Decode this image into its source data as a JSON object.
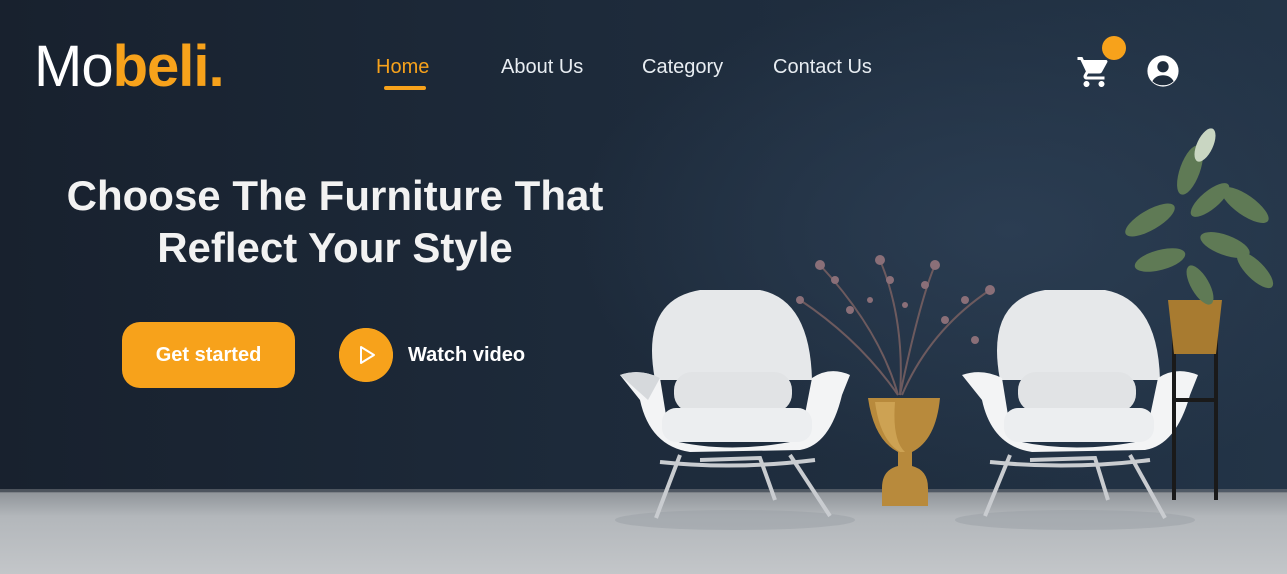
{
  "brand": {
    "part1": "Mo",
    "part2": "beli."
  },
  "nav": {
    "items": [
      {
        "label": "Home",
        "active": true
      },
      {
        "label": "About Us",
        "active": false
      },
      {
        "label": "Category",
        "active": false
      },
      {
        "label": "Contact Us",
        "active": false
      }
    ]
  },
  "header_icons": {
    "cart": "cart-icon",
    "badge": "notification-dot",
    "account": "user-account-icon"
  },
  "hero": {
    "headline_line1": "Choose The Furniture That",
    "headline_line2": "Reflect Your Style",
    "primary_button": "Get started",
    "secondary_action": "Watch video",
    "secondary_icon": "play-icon"
  },
  "colors": {
    "accent": "#f7a21b",
    "wall": "#1c2a3a",
    "text": "#f2f2f2"
  }
}
